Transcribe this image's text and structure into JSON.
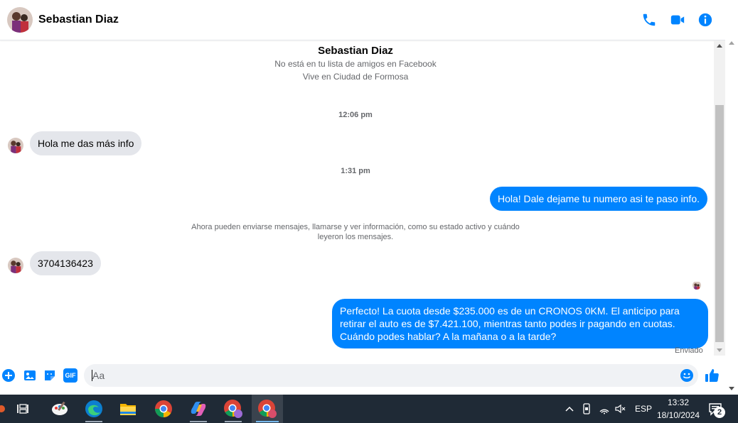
{
  "header": {
    "contact_name": "Sebastian Diaz"
  },
  "intro": {
    "name": "Sebastian Diaz",
    "line1": "No está en tu lista de amigos en Facebook",
    "line2": "Vive en Ciudad de Formosa"
  },
  "messages": [
    {
      "type": "timestamp",
      "text": "12:06 pm"
    },
    {
      "type": "incoming",
      "text": "Hola me das más info"
    },
    {
      "type": "timestamp",
      "text": "1:31 pm"
    },
    {
      "type": "outgoing",
      "text": "Hola! Dale dejame tu numero  asi te paso info."
    },
    {
      "type": "system",
      "text": "Ahora pueden enviarse mensajes, llamarse y ver información, como su estado activo y cuándo leyeron los mensajes."
    },
    {
      "type": "incoming",
      "text": "3704136423"
    },
    {
      "type": "outgoing",
      "text": "Perfecto! La cuota desde $235.000 es de un CRONOS 0KM. El anticipo para retirar el auto es de $7.421.100, mientras tanto podes ir pagando en cuotas. Cuándo podes hablar? A la mañana o a la tarde?"
    }
  ],
  "status": {
    "sent_label": "Enviado"
  },
  "composer": {
    "placeholder": "Aa",
    "gif_label": "GIF"
  },
  "taskbar": {
    "language": "ESP",
    "time": "13:32",
    "date": "18/10/2024",
    "notification_count": "2"
  },
  "colors": {
    "messenger_blue": "#0084ff",
    "incoming_bubble": "#e4e6eb",
    "taskbar_bg": "#1f2a36"
  }
}
